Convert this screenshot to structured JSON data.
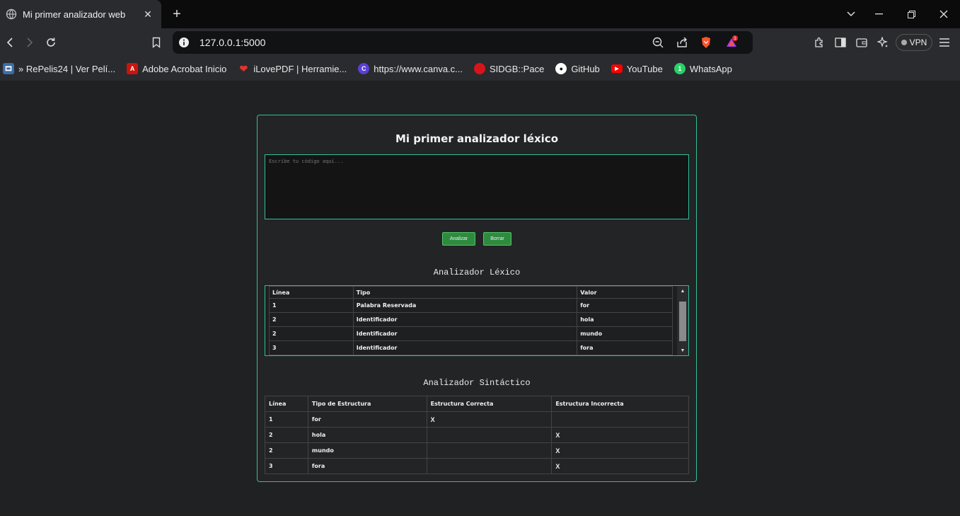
{
  "browser": {
    "tab_title": "Mi primer analizador web",
    "url": "127.0.0.1:5000",
    "notification_count": "1",
    "vpn_label": "VPN",
    "bookmarks": [
      {
        "label": "» RePelis24 | Ver Pelí...",
        "color": "#3a6ea5"
      },
      {
        "label": "Adobe Acrobat Inicio",
        "color": "#c9150e"
      },
      {
        "label": "iLovePDF | Herramie...",
        "color": "#e5322d"
      },
      {
        "label": "https://www.canva.c...",
        "color": "#5b3fd6"
      },
      {
        "label": "SIDGB::Pace",
        "color": "#d6151b"
      },
      {
        "label": "GitHub",
        "color": "#ffffff"
      },
      {
        "label": "YouTube",
        "color": "#ff0000"
      },
      {
        "label": "WhatsApp",
        "color": "#25d366"
      }
    ]
  },
  "app": {
    "title": "Mi primer analizador léxico",
    "input_placeholder": "Escribe tu código aquí...",
    "analyze_label": "Analizar",
    "clear_label": "Borrar",
    "accent_color": "#2fbf9a",
    "button_color": "#2e8b3e"
  },
  "lexical": {
    "title": "Analizador Léxico",
    "headers": [
      "Línea",
      "Tipo",
      "Valor"
    ],
    "rows": [
      [
        "1",
        "Palabra Reservada",
        "for"
      ],
      [
        "2",
        "Identificador",
        "hola"
      ],
      [
        "2",
        "Identificador",
        "mundo"
      ],
      [
        "3",
        "Identificador",
        "fora"
      ]
    ]
  },
  "syntactic": {
    "title": "Analizador Sintáctico",
    "headers": [
      "Línea",
      "Tipo de Estructura",
      "Estructura Correcta",
      "Estructura Incorrecta"
    ],
    "rows": [
      [
        "1",
        "for",
        "X",
        ""
      ],
      [
        "2",
        "hola",
        "",
        "X"
      ],
      [
        "2",
        "mundo",
        "",
        "X"
      ],
      [
        "3",
        "fora",
        "",
        "X"
      ]
    ]
  }
}
